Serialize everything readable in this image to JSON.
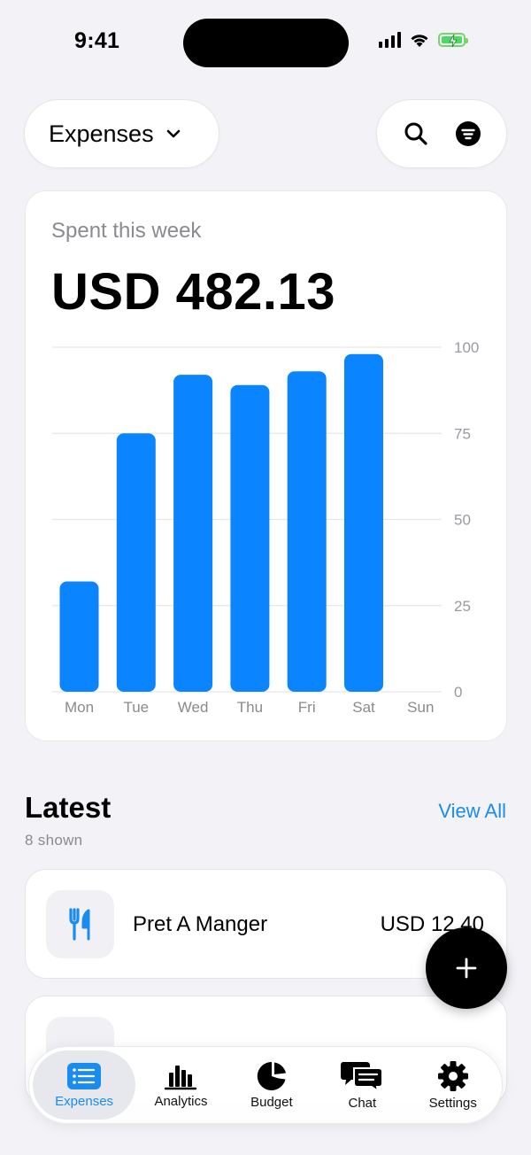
{
  "status_bar": {
    "time": "9:41"
  },
  "header": {
    "title": "Expenses"
  },
  "chart_data": {
    "type": "bar",
    "title": "Spent this week",
    "total": "USD 482.13",
    "categories": [
      "Mon",
      "Tue",
      "Wed",
      "Thu",
      "Fri",
      "Sat",
      "Sun"
    ],
    "values": [
      32,
      75,
      92,
      89,
      93,
      98,
      0
    ],
    "ylim": [
      0,
      100
    ],
    "yticks": [
      "100",
      "75",
      "50",
      "25",
      "0"
    ],
    "grid": true,
    "bar_color": "#0a84ff"
  },
  "latest": {
    "title": "Latest",
    "count": "8 shown",
    "view_all": "View All",
    "items": [
      {
        "name": "Pret A Manger",
        "amount": "USD 12.40",
        "icon": "fork-knife-icon"
      }
    ]
  },
  "tabs": [
    {
      "label": "Expenses",
      "icon": "list-icon",
      "active": true
    },
    {
      "label": "Analytics",
      "icon": "bar-chart-icon",
      "active": false
    },
    {
      "label": "Budget",
      "icon": "pie-chart-icon",
      "active": false
    },
    {
      "label": "Chat",
      "icon": "chat-icon",
      "active": false
    },
    {
      "label": "Settings",
      "icon": "gear-icon",
      "active": false
    }
  ],
  "colors": {
    "accent": "#1a8cf0",
    "background": "#f2f2f7"
  }
}
